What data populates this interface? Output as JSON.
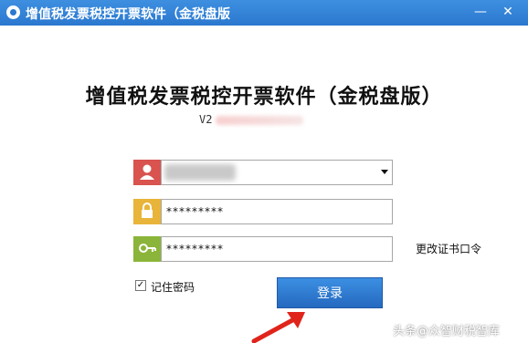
{
  "window": {
    "title": "增值税发票税控开票软件（金税盘版",
    "minimize_label": "—",
    "close_label": "✕"
  },
  "login": {
    "title": "增值税发票税控开票软件（金税盘版）",
    "version": "V2",
    "username_value": "",
    "password_value": "*********",
    "cert_password_value": "*********",
    "change_cert_label": "更改证书口令",
    "remember_checked": true,
    "remember_label": "记住密码",
    "login_button": "登录"
  },
  "watermark": "头条@众智财税智库",
  "icons": {
    "app": "app-logo-icon",
    "user": "user-icon",
    "lock": "lock-icon",
    "key": "key-icon",
    "dropdown": "chevron-down-icon",
    "check": "checkmark-icon",
    "arrow": "red-arrow-icon"
  }
}
